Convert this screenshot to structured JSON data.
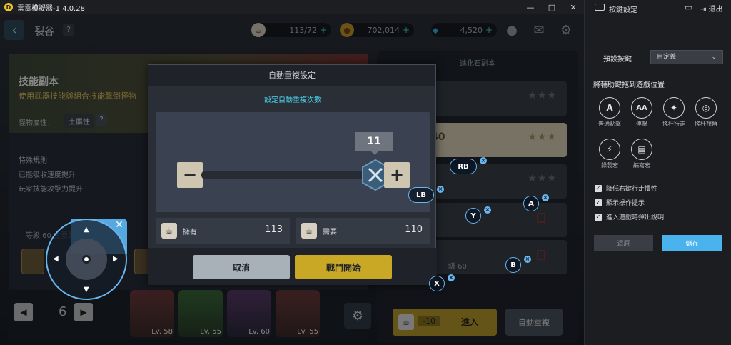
{
  "emulator": {
    "title": "雷電模擬器-1 4.0.28",
    "logo_glyph": "D",
    "window_controls": [
      "—",
      "□",
      "✕"
    ]
  },
  "game": {
    "page_title": "裂谷",
    "help": "?",
    "resources": {
      "stamina": "113/72",
      "gold": "702,014",
      "gems": "4,520"
    },
    "info": {
      "title": "技能副本",
      "subtitle": "使用武器技能與組合技能擊倒怪物",
      "attr_label": "怪物屬性：",
      "attr_value": "土屬性",
      "attr_help": "?",
      "rules": [
        "特殊規則",
        "已能吸收速度提升",
        "玩家技能攻擊力提升"
      ],
      "level_label": "等級 60  主要獎勵"
    },
    "pager": {
      "prev": "◀",
      "next": "▶",
      "page": "6",
      "characters": [
        {
          "lv": "Lv. 58"
        },
        {
          "lv": "Lv. 55"
        },
        {
          "lv": "Lv. 60"
        },
        {
          "lv": "Lv. 55"
        }
      ]
    },
    "stages": {
      "panel_title": "進化石副本",
      "stars": "★★★",
      "active_num": "40",
      "level_text": "級 60"
    },
    "enter": {
      "cost": "-10",
      "label": "進入"
    },
    "auto_repeat": "自動重複"
  },
  "modal": {
    "title": "自動重複設定",
    "subtitle": "設定自動重複次數",
    "count": "11",
    "minus": "−",
    "plus": "+",
    "owned_label": "擁有",
    "owned_value": "113",
    "required_label": "需要",
    "required_value": "110",
    "cancel": "取消",
    "start": "戰鬥開始"
  },
  "overlay": {
    "joystick_close": "✕",
    "keys": [
      "RB",
      "LB",
      "Y",
      "A",
      "B",
      "X"
    ],
    "key_close": "×"
  },
  "sidebar": {
    "title": "按鍵設定",
    "exit": "退出",
    "preset_label": "預設按鍵",
    "preset_value": "自定義",
    "drag_hint": "將輔助鍵拖到遊戲位置",
    "tools": [
      {
        "glyph": "A",
        "label": "普通點擊"
      },
      {
        "glyph": "AA",
        "label": "連擊"
      },
      {
        "glyph": "✦",
        "label": "搖杆行走"
      },
      {
        "glyph": "◎",
        "label": "搖杆視角"
      },
      {
        "glyph": "⚡",
        "label": "錄製宏"
      },
      {
        "glyph": "▤",
        "label": "編寫宏"
      }
    ],
    "options": [
      "降低右鍵行走慣性",
      "顯示操作提示",
      "進入遊戲時彈出說明"
    ],
    "restore": "還原",
    "save": "儲存"
  }
}
